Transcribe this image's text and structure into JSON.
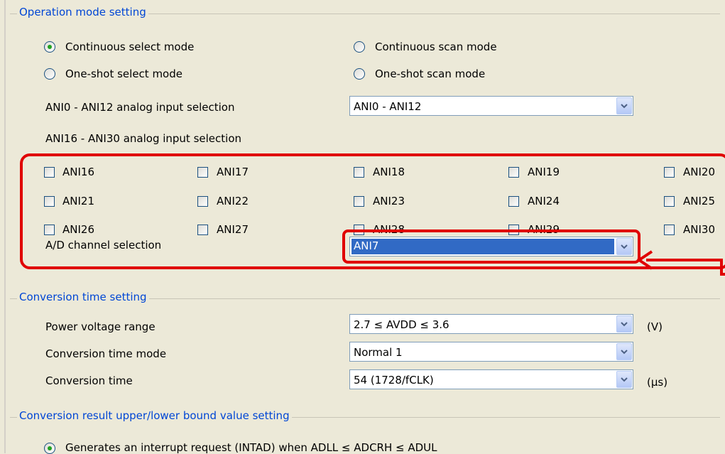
{
  "operation_mode": {
    "group_title": "Operation mode setting",
    "radios": [
      {
        "label": "Continuous select mode",
        "checked": true
      },
      {
        "label": "Continuous scan mode",
        "checked": false
      },
      {
        "label": "One-shot select mode",
        "checked": false
      },
      {
        "label": "One-shot scan mode",
        "checked": false
      }
    ],
    "ani0_label": "ANI0 - ANI12 analog input selection",
    "ani0_value": "ANI0 - ANI12",
    "ani16_label": "ANI16 - ANI30 analog input selection",
    "checkboxes": [
      "ANI16",
      "ANI17",
      "ANI18",
      "ANI19",
      "ANI20",
      "ANI21",
      "ANI22",
      "ANI23",
      "ANI24",
      "ANI25",
      "ANI26",
      "ANI27",
      "ANI28",
      "ANI29",
      "ANI30"
    ],
    "channel_label": "A/D channel selection",
    "channel_value": "ANI7"
  },
  "conversion_time": {
    "group_title": "Conversion time setting",
    "rows": [
      {
        "label": "Power voltage range",
        "value": "2.7 ≤ AVDD ≤ 3.6",
        "unit": "(V)"
      },
      {
        "label": "Conversion time mode",
        "value": "Normal 1",
        "unit": ""
      },
      {
        "label": "Conversion time",
        "value": "54 (1728/fCLK)",
        "unit": "(µs)"
      }
    ]
  },
  "bound_setting": {
    "group_title": "Conversion result upper/lower bound value setting",
    "radio_label": "Generates an interrupt request (INTAD) when ADLL ≤ ADCRH ≤ ADUL"
  },
  "annotation_color": "#e00000"
}
